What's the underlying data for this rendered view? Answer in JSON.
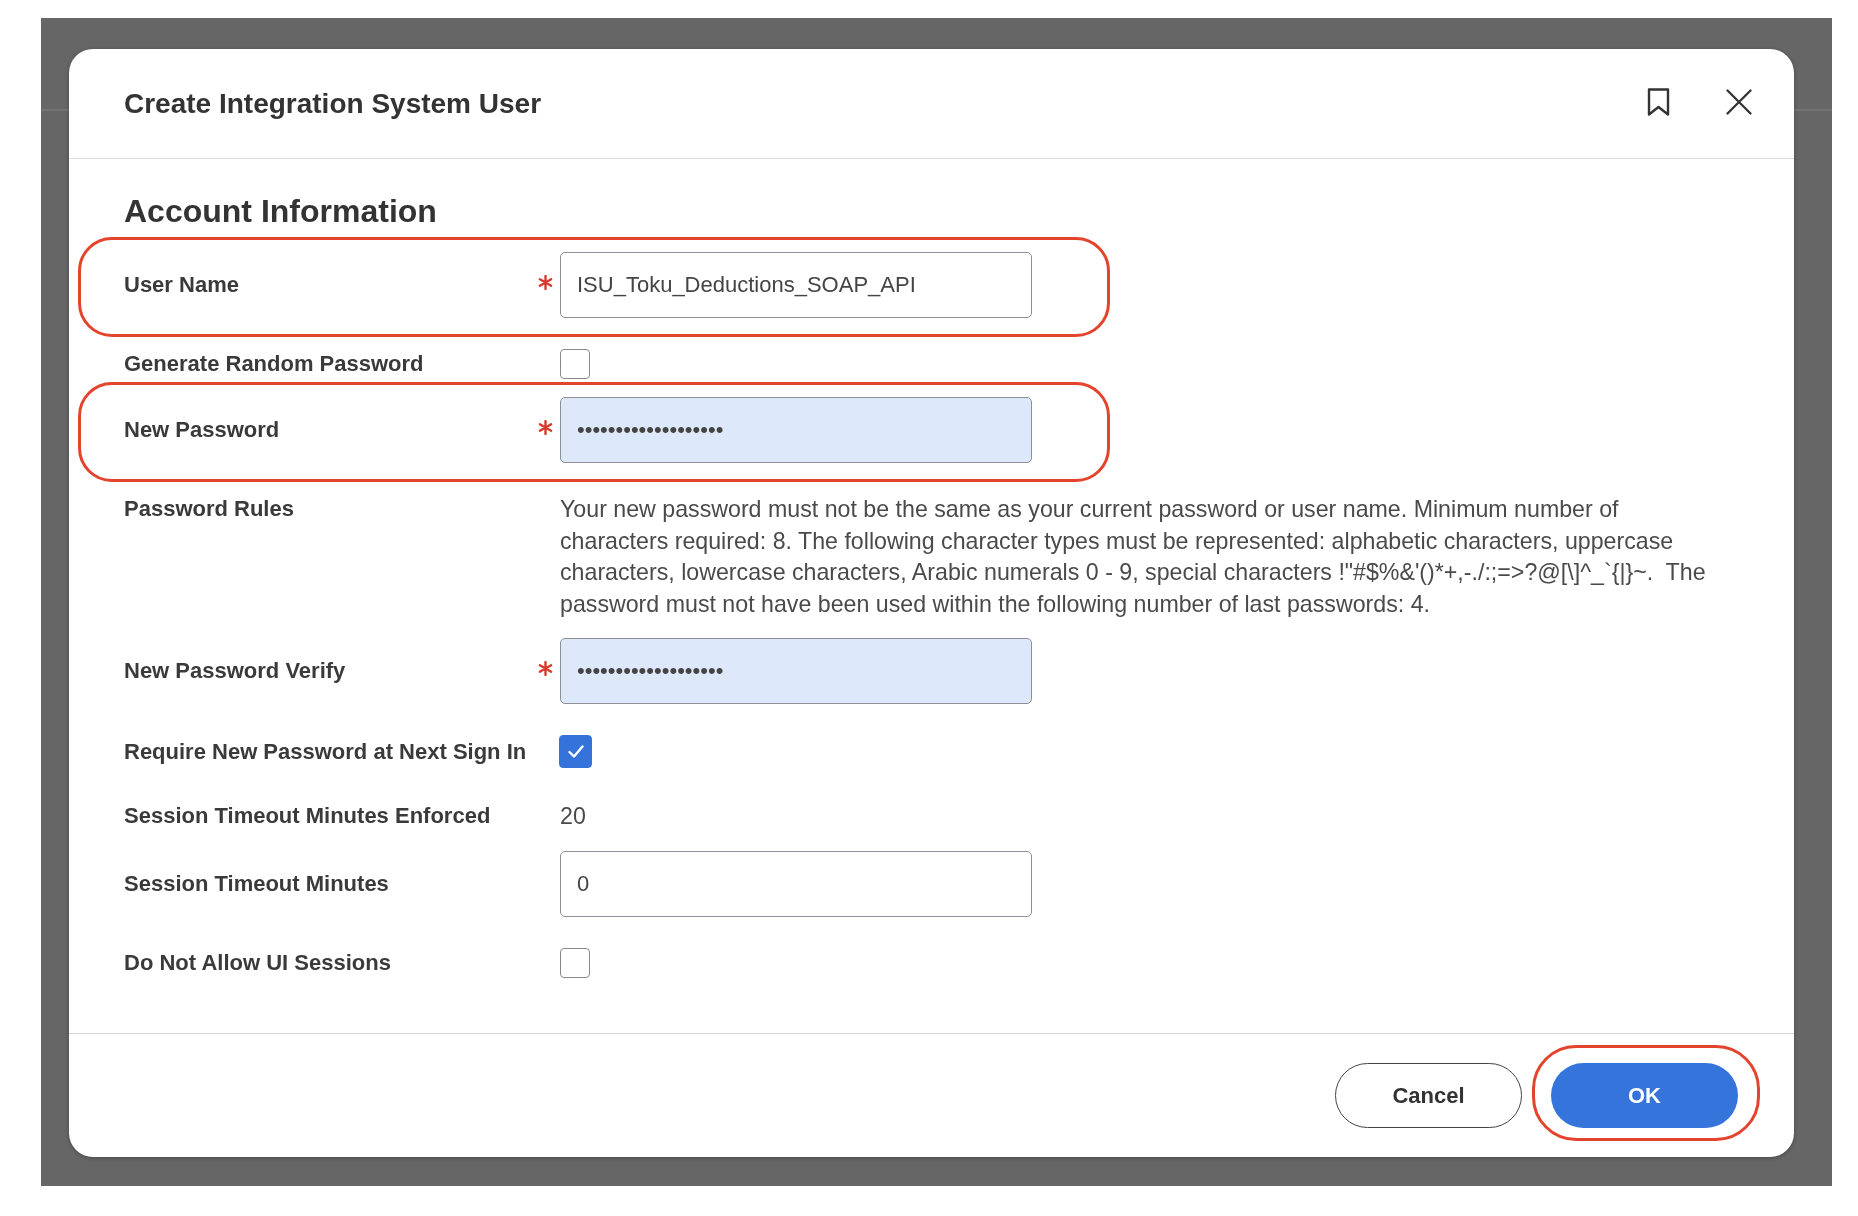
{
  "dialog": {
    "title": "Create Integration System User"
  },
  "section": {
    "title": "Account Information"
  },
  "fields": [
    {
      "kind": "text",
      "label": "User Name",
      "required": true,
      "value": "ISU_Toku_Deductions_SOAP_API",
      "autofilled": false,
      "highlighted": true
    },
    {
      "kind": "checkbox",
      "label": "Generate Random Password",
      "required": false,
      "checked": false,
      "highlighted": false
    },
    {
      "kind": "text",
      "label": "New Password",
      "required": true,
      "value": "•••••••••••••••••••",
      "autofilled": true,
      "highlighted": true
    },
    {
      "kind": "static",
      "label": "Password Rules",
      "required": false,
      "value": "Your new password must not be the same as your current password or user name. Minimum number of characters required: 8. The following character types must be represented: alphabetic characters, uppercase characters, lowercase characters, Arabic numerals 0 - 9, special characters !\"#$%&'()*+,-./:;=>?@[\\]^_`{|}~.  The password must not have been used within the following number of last passwords: 4.",
      "highlighted": false
    },
    {
      "kind": "text",
      "label": "New Password Verify",
      "required": true,
      "value": "•••••••••••••••••••",
      "autofilled": true,
      "highlighted": false
    },
    {
      "kind": "checkbox",
      "label": "Require New Password at Next Sign In",
      "required": false,
      "checked": true,
      "highlighted": false
    },
    {
      "kind": "static",
      "label": "Session Timeout Minutes Enforced",
      "required": false,
      "value": "20",
      "highlighted": false
    },
    {
      "kind": "text",
      "label": "Session Timeout Minutes",
      "required": false,
      "value": "0",
      "autofilled": false,
      "highlighted": false
    },
    {
      "kind": "checkbox",
      "label": "Do Not Allow UI Sessions",
      "required": false,
      "checked": false,
      "highlighted": false
    }
  ],
  "buttons": [
    {
      "kind": "secondary",
      "label": "Cancel",
      "highlighted": false
    },
    {
      "kind": "primary",
      "label": "OK",
      "highlighted": true
    }
  ]
}
